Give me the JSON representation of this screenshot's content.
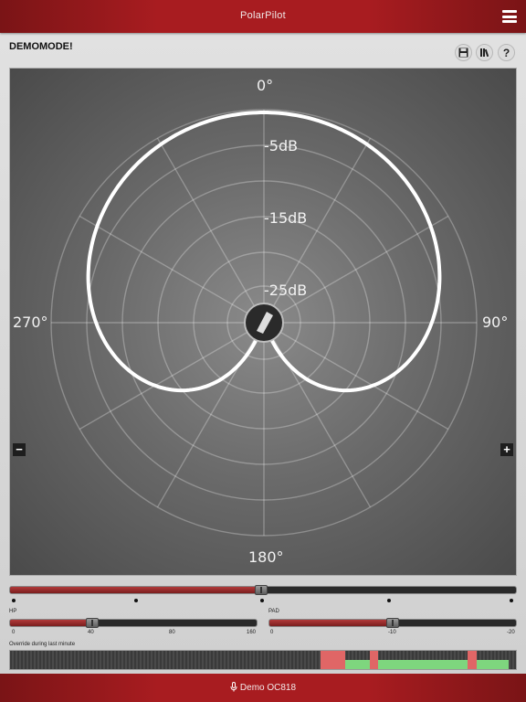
{
  "app": {
    "title": "PolarPilot"
  },
  "status": {
    "text": "DEMOMODE!"
  },
  "toolbar": {
    "save_icon": "floppy-disk-icon",
    "library_icon": "books-icon",
    "help_label": "?"
  },
  "polar": {
    "angles": {
      "top": "0°",
      "right": "90°",
      "bottom": "180°",
      "left": "270°"
    },
    "db_labels": [
      "-5dB",
      "-15dB",
      "-25dB"
    ],
    "zoom_out": "−",
    "zoom_in": "+",
    "pattern": "cardioid",
    "line_color": "#ffffff"
  },
  "pattern_slider": {
    "value_fraction": 0.5,
    "fill_color": "#9a2a2a"
  },
  "hp": {
    "label": "HP",
    "ticks": [
      "0",
      "40",
      "80",
      "160"
    ],
    "value": "40"
  },
  "pad": {
    "label": "PAD",
    "ticks": [
      "0",
      "-10",
      "-20"
    ],
    "value": "-10"
  },
  "override": {
    "label": "Override during last minute",
    "colors": {
      "red": "#e06666",
      "green": "#7ed67e"
    }
  },
  "device": {
    "icon": "microphone-icon",
    "name": "Demo OC818"
  }
}
